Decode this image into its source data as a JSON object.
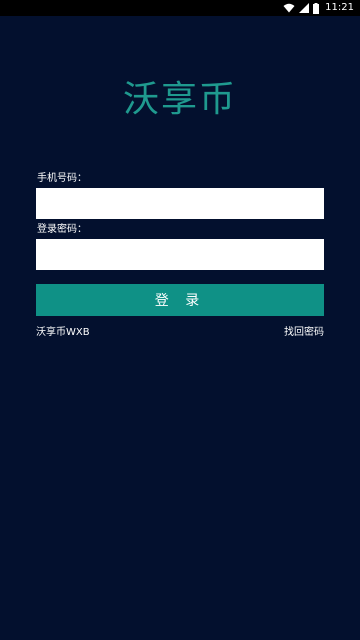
{
  "status_bar": {
    "time": "11:21",
    "icons": [
      "wifi-icon",
      "signal-icon",
      "battery-icon"
    ]
  },
  "app": {
    "title": "沃享币"
  },
  "form": {
    "phone_label": "手机号码：",
    "phone_value": "",
    "password_label": "登录密码：",
    "password_value": "",
    "login_button": "登 录"
  },
  "footer": {
    "left_text": "沃享币WXB",
    "right_link": "找回密码"
  },
  "colors": {
    "background": "#03102e",
    "accent": "#0f9186",
    "title": "#1f9a8f"
  }
}
